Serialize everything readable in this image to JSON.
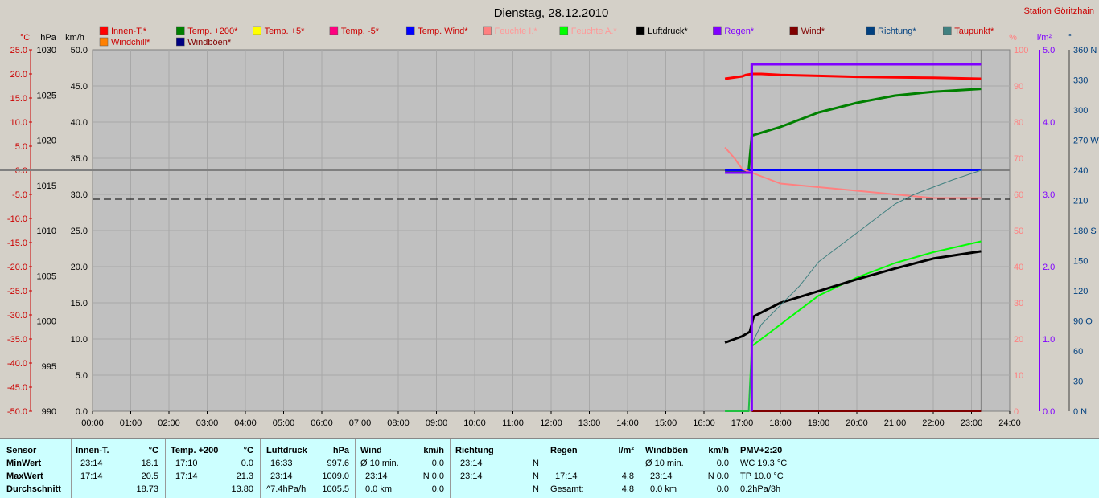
{
  "header": {
    "title": "Dienstag, 28.12.2010",
    "station": "Station Göritzhain"
  },
  "legend": [
    {
      "label": "Innen-T.*",
      "color": "#ff0000",
      "text_color": "#cc0000"
    },
    {
      "label": "Temp. +200*",
      "color": "#008000",
      "text_color": "#cc0000"
    },
    {
      "label": "Temp. +5*",
      "color": "#ffff00",
      "text_color": "#cc0000"
    },
    {
      "label": "Temp. -5*",
      "color": "#ff0080",
      "text_color": "#cc0000"
    },
    {
      "label": "Temp. Wind*",
      "color": "#0000ff",
      "text_color": "#cc0000"
    },
    {
      "label": "Feuchte I.*",
      "color": "#ff8080",
      "text_color": "#ff9999"
    },
    {
      "label": "Feuchte A.*",
      "color": "#00ff00",
      "text_color": "#ff9999"
    },
    {
      "label": "Luftdruck*",
      "color": "#000000",
      "text_color": "#000000"
    },
    {
      "label": "Regen*",
      "color": "#8000ff",
      "text_color": "#8000ff"
    },
    {
      "label": "Wind*",
      "color": "#800000",
      "text_color": "#800000"
    },
    {
      "label": "Richtung*",
      "color": "#004080",
      "text_color": "#004080"
    },
    {
      "label": "Taupunkt*",
      "color": "#408080",
      "text_color": "#cc0000"
    },
    {
      "label": "Windchill*",
      "color": "#ff8000",
      "text_color": "#cc0000"
    },
    {
      "label": "Windböen*",
      "color": "#000080",
      "text_color": "#800000"
    }
  ],
  "axis_units": {
    "temp": "°C",
    "hpa": "hPa",
    "kmh": "km/h",
    "pct": "%",
    "rain": "l/m²",
    "dir": "°"
  },
  "chart_data": {
    "type": "line",
    "title": "Dienstag, 28.12.2010",
    "xlabel": "",
    "x_ticks": [
      "00:00",
      "01:00",
      "02:00",
      "03:00",
      "04:00",
      "05:00",
      "06:00",
      "07:00",
      "08:00",
      "09:00",
      "10:00",
      "11:00",
      "12:00",
      "13:00",
      "14:00",
      "15:00",
      "16:00",
      "17:00",
      "18:00",
      "19:00",
      "20:00",
      "21:00",
      "22:00",
      "23:00",
      "24:00"
    ],
    "xlim_hours": [
      0,
      24
    ],
    "axes": {
      "temp": {
        "unit": "°C",
        "lim": [
          -50,
          25
        ],
        "ticks": [
          "25.0",
          "20.0",
          "15.0",
          "10.0",
          "5.0",
          "0.0",
          "-5.0",
          "-10.0",
          "-15.0",
          "-20.0",
          "-25.0",
          "-30.0",
          "-35.0",
          "-40.0",
          "-45.0",
          "-50.0"
        ]
      },
      "hpa": {
        "unit": "hPa",
        "lim": [
          990,
          1030
        ],
        "ticks": [
          "1030",
          "1025",
          "1020",
          "1015",
          "1010",
          "1005",
          "1000",
          "995",
          "990"
        ]
      },
      "kmh": {
        "unit": "km/h",
        "lim": [
          0,
          50
        ],
        "ticks": [
          "50.0",
          "45.0",
          "40.0",
          "35.0",
          "30.0",
          "25.0",
          "20.0",
          "15.0",
          "10.0",
          "5.0",
          "0.0"
        ]
      },
      "pct": {
        "unit": "%",
        "lim": [
          0,
          100
        ],
        "ticks": [
          "100",
          "90",
          "80",
          "70",
          "60",
          "50",
          "40",
          "30",
          "20",
          "10",
          "0"
        ]
      },
      "rain": {
        "unit": "l/m²",
        "lim": [
          0,
          5
        ],
        "ticks": [
          "5.0",
          "4.0",
          "3.0",
          "2.0",
          "1.0",
          "0.0"
        ]
      },
      "dir": {
        "unit": "°",
        "lim": [
          0,
          360
        ],
        "ticks": [
          "360 N",
          "330",
          "300",
          "270 W",
          "240",
          "210",
          "180 S",
          "150",
          "120",
          "90 O",
          "60",
          "30",
          "0 N"
        ]
      }
    },
    "reference_lines": [
      {
        "axis": "temp",
        "y": 0,
        "style": "solid",
        "color": "#808080"
      },
      {
        "axis": "temp",
        "y": -6,
        "style": "dashed",
        "color": "#000000"
      }
    ],
    "series": [
      {
        "name": "Innen-T.*",
        "axis": "temp",
        "color": "#ff0000",
        "width": 3,
        "x": [
          16.55,
          17.0,
          17.1,
          17.25,
          17.5,
          18.0,
          19.0,
          20.0,
          21.0,
          22.0,
          23.25
        ],
        "y": [
          19.0,
          19.5,
          19.8,
          20.0,
          20.0,
          19.8,
          19.6,
          19.4,
          19.3,
          19.2,
          19.0
        ]
      },
      {
        "name": "Temp. +200*",
        "axis": "temp",
        "color": "#008000",
        "width": 3,
        "x": [
          16.55,
          17.0,
          17.17,
          17.25,
          18.0,
          18.5,
          19.0,
          19.5,
          20.0,
          21.0,
          22.0,
          23.25
        ],
        "y": [
          0.0,
          0.0,
          0.0,
          7.2,
          9.0,
          10.5,
          12.0,
          13.0,
          14.0,
          15.5,
          16.3,
          16.9
        ]
      },
      {
        "name": "Temp. Wind*",
        "axis": "temp",
        "color": "#0000ff",
        "width": 2,
        "x": [
          16.55,
          17.25,
          23.25
        ],
        "y": [
          0.0,
          0.0,
          0.0
        ]
      },
      {
        "name": "Feuchte I.*",
        "axis": "pct",
        "color": "#ff8080",
        "width": 2,
        "x": [
          16.55,
          16.8,
          17.0,
          17.25,
          18.0,
          19.0,
          20.0,
          21.0,
          22.0,
          23.25
        ],
        "y": [
          73,
          70,
          67,
          66,
          63,
          62,
          61,
          60,
          59,
          59
        ]
      },
      {
        "name": "Feuchte A.*",
        "axis": "pct",
        "color": "#00ff00",
        "width": 2,
        "x": [
          16.55,
          17.17,
          17.25,
          18.0,
          19.0,
          20.0,
          21.0,
          22.0,
          23.25
        ],
        "y": [
          0,
          0,
          18,
          24,
          32,
          37,
          41,
          44,
          47
        ]
      },
      {
        "name": "Luftdruck*",
        "axis": "hpa",
        "color": "#000000",
        "width": 3,
        "x": [
          16.55,
          17.0,
          17.2,
          17.3,
          18.0,
          19.0,
          20.0,
          21.0,
          22.0,
          23.25
        ],
        "y": [
          997.6,
          998.3,
          998.8,
          1000.5,
          1002.0,
          1003.3,
          1004.6,
          1005.8,
          1006.9,
          1007.7
        ]
      },
      {
        "name": "Regen*",
        "axis": "rain",
        "color": "#8000ff",
        "width": 3,
        "x": [
          16.55,
          17.25,
          17.25,
          23.25
        ],
        "y": [
          3.3,
          3.3,
          4.8,
          4.8
        ]
      },
      {
        "name": "Wind*",
        "axis": "kmh",
        "color": "#800000",
        "width": 2,
        "x": [
          17.25,
          23.25
        ],
        "y": [
          0.0,
          0.0
        ]
      },
      {
        "name": "Taupunkt*",
        "axis": "temp",
        "color": "#408080",
        "width": 1,
        "x": [
          16.55,
          17.17,
          17.25,
          17.5,
          18.0,
          18.5,
          19.0,
          19.5,
          20.0,
          20.5,
          21.0,
          21.5,
          22.0,
          22.5,
          23.25
        ],
        "y": [
          -50.0,
          -50.0,
          -36.0,
          -32.0,
          -28.0,
          -24.0,
          -19.0,
          -16.0,
          -13.0,
          -10.0,
          -7.0,
          -5.0,
          -3.5,
          -2.0,
          0.0
        ]
      }
    ]
  },
  "stats": {
    "headers": {
      "sensor": "Sensor",
      "innen": "Innen-T.",
      "innen_unit": "°C",
      "temp": "Temp. +200",
      "temp_unit": "°C",
      "luft": "Luftdruck",
      "luft_unit": "hPa",
      "wind": "Wind",
      "wind_unit": "km/h",
      "richtung": "Richtung",
      "regen": "Regen",
      "regen_unit": "l/m²",
      "boeen": "Windböen",
      "boeen_unit": "km/h",
      "pmv": "PMV+2:20"
    },
    "rows": {
      "min_label": "MinWert",
      "max_label": "MaxWert",
      "avg_label": "Durchschnitt"
    },
    "innen": {
      "min_time": "23:14",
      "min_val": "18.1",
      "max_time": "17:14",
      "max_val": "20.5",
      "avg": "18.73"
    },
    "temp": {
      "min_time": "17:10",
      "min_val": "0.0",
      "max_time": "17:14",
      "max_val": "21.3",
      "avg": "13.80"
    },
    "luft": {
      "min_time": "16:33",
      "min_val": "997.6",
      "max_time": "23:14",
      "max_val": "1009.0",
      "avg_label": "^7.4hPa/h",
      "avg": "1005.5"
    },
    "wind": {
      "r1_label": "Ø 10 min.",
      "r1_val": "0.0",
      "r2_label": "23:14",
      "r2_val": "N 0.0",
      "r3_label": "0.0 km",
      "r3_val": "0.0"
    },
    "richtung": {
      "r1_time": "23:14",
      "r1_val": "N",
      "r2_time": "23:14",
      "r2_val": "N",
      "r3_val": "N"
    },
    "regen": {
      "r2_time": "17:14",
      "r2_val": "4.8",
      "r3_label": "Gesamt:",
      "r3_val": "4.8"
    },
    "boeen": {
      "r1_label": "Ø 10 min.",
      "r1_val": "0.0",
      "r2_label": "23:14",
      "r2_val": "N 0.0",
      "r3_label": "0.0 km",
      "r3_val": "0.0"
    },
    "pmv": {
      "r1": "WC 19.3 °C",
      "r2": "TP 10.0 °C",
      "r3": "0.2hPa/3h"
    }
  }
}
